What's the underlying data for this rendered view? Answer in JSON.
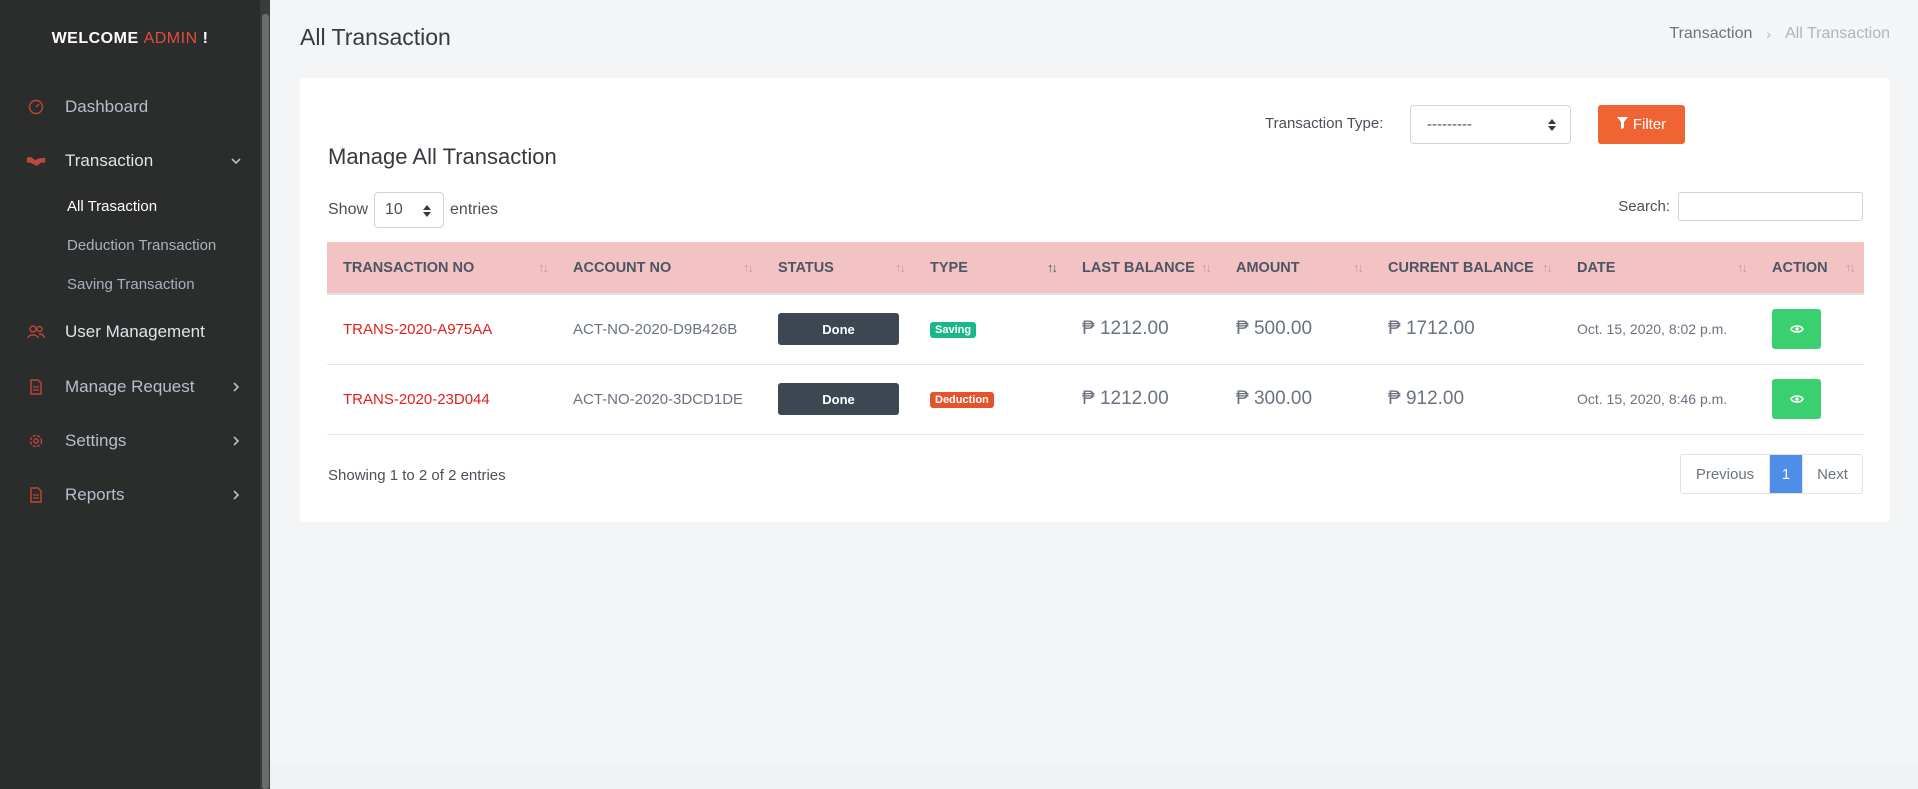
{
  "sidebar": {
    "welcome_prefix": "WELCOME",
    "welcome_user": "ADMIN",
    "welcome_suffix": "!",
    "items": [
      {
        "label": "Dashboard",
        "icon": "speedometer-icon"
      },
      {
        "label": "Transaction",
        "icon": "handshake-icon",
        "expanded": true,
        "children": [
          "All Trasaction",
          "Deduction Transaction",
          "Saving Transaction"
        ]
      },
      {
        "label": "User Management",
        "icon": "users-icon"
      },
      {
        "label": "Manage Request",
        "icon": "file-icon"
      },
      {
        "label": "Settings",
        "icon": "gear-icon"
      },
      {
        "label": "Reports",
        "icon": "report-icon"
      }
    ]
  },
  "header": {
    "title": "All Transaction",
    "breadcrumb": [
      "Transaction",
      "All Transaction"
    ]
  },
  "filter": {
    "label": "Transaction Type:",
    "selected": "---------",
    "button": "Filter"
  },
  "card": {
    "title": "Manage All Transaction",
    "show_label": "Show",
    "page_length": "10",
    "entries_label": "entries",
    "search_label": "Search:"
  },
  "table": {
    "columns": [
      "TRANSACTION NO",
      "ACCOUNT NO",
      "STATUS",
      "TYPE",
      "LAST BALANCE",
      "AMOUNT",
      "CURRENT BALANCE",
      "DATE",
      "ACTION"
    ],
    "rows": [
      {
        "txn": "TRANS-2020-A975AA",
        "account": "ACT-NO-2020-D9B426B",
        "status": "Done",
        "type": "Saving",
        "last_balance": "₱ 1212.00",
        "amount": "₱ 500.00",
        "current_balance": "₱ 1712.00",
        "date": "Oct. 15, 2020, 8:02 p.m."
      },
      {
        "txn": "TRANS-2020-23D044",
        "account": "ACT-NO-2020-3DCD1DE",
        "status": "Done",
        "type": "Deduction",
        "last_balance": "₱ 1212.00",
        "amount": "₱ 300.00",
        "current_balance": "₱ 912.00",
        "date": "Oct. 15, 2020, 8:46 p.m."
      }
    ]
  },
  "pagination": {
    "info": "Showing 1 to 2 of 2 entries",
    "previous": "Previous",
    "current": "1",
    "next": "Next"
  },
  "colors": {
    "accent": "#e14d3b",
    "filter_button": "#f06434",
    "table_header": "#f3c2c2",
    "saving": "#1bb78a",
    "deduction": "#e3542c",
    "view_button": "#3bd06f",
    "active_page": "#4f8ee8"
  }
}
